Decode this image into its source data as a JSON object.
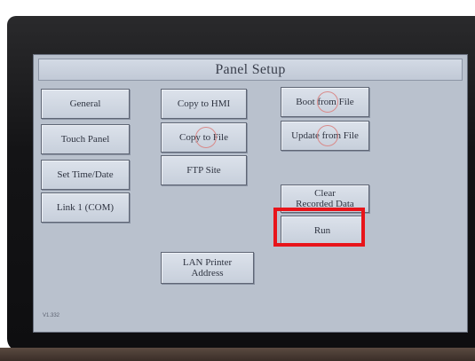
{
  "panel": {
    "title": "Panel Setup",
    "footer_label": "V1.332"
  },
  "buttons": {
    "general": "General",
    "touch_panel": "Touch Panel",
    "set_time_date": "Set Time/Date",
    "link1_com": "Link 1 (COM)",
    "copy_to_hmi": "Copy to HMI",
    "copy_to_file": "Copy to File",
    "ftp_site": "FTP Site",
    "lan_printer_address": "LAN Printer\nAddress",
    "boot_from_file": "Boot from File",
    "update_from_file": "Update from File",
    "clear_recorded_data": "Clear\nRecorded Data",
    "run": "Run"
  },
  "annotation": {
    "highlight_color": "#e8141a",
    "highlighted_button": "Run"
  }
}
